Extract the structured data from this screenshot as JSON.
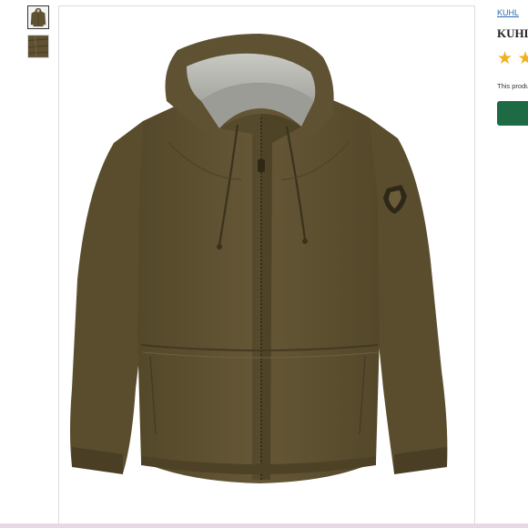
{
  "gallery": {
    "thumbnails": [
      {
        "icon": "jacket-front-thumbnail",
        "selected": true
      },
      {
        "icon": "jacket-detail-thumbnail",
        "selected": false
      }
    ],
    "main_image": {
      "icon": "olive-hooded-jacket-image"
    }
  },
  "product": {
    "brand_link": "KUHL",
    "title": "KUHL",
    "rating_stars": [
      "★",
      "★"
    ],
    "description_snippet": "This produ"
  },
  "colors": {
    "jacket": "#5f5232",
    "hood_lining": "#b9b9b4",
    "star": "#f2b01e",
    "cta_button": "#1d6a44",
    "link": "#2a6bb3"
  }
}
